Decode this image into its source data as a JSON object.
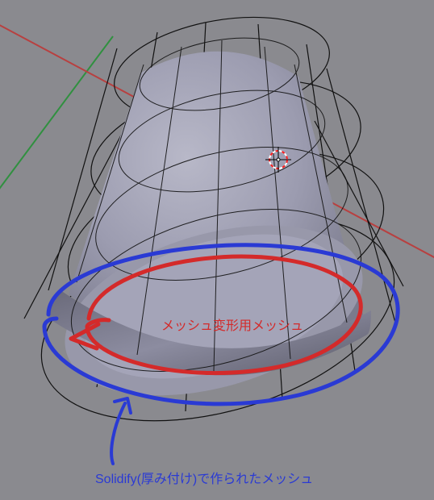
{
  "viewport": {
    "background_color": "#8a8a8f",
    "axis_x_color": "#c03030",
    "axis_y_color": "#309040",
    "axis_z_color": "#3030c0",
    "cursor_color_primary": "#ff0000",
    "cursor_color_secondary": "#ffffff"
  },
  "object": {
    "type": "mesh-cylinder-tapered",
    "display_mode": "wireframe-over-shaded"
  },
  "annotations": {
    "inner_ring_label": "メッシュ変形用メッシュ",
    "inner_ring_color": "#d42a2a",
    "outer_ring_label": "Solidify(厚み付け)で作られたメッシュ",
    "outer_ring_color": "#2a3ad4"
  }
}
